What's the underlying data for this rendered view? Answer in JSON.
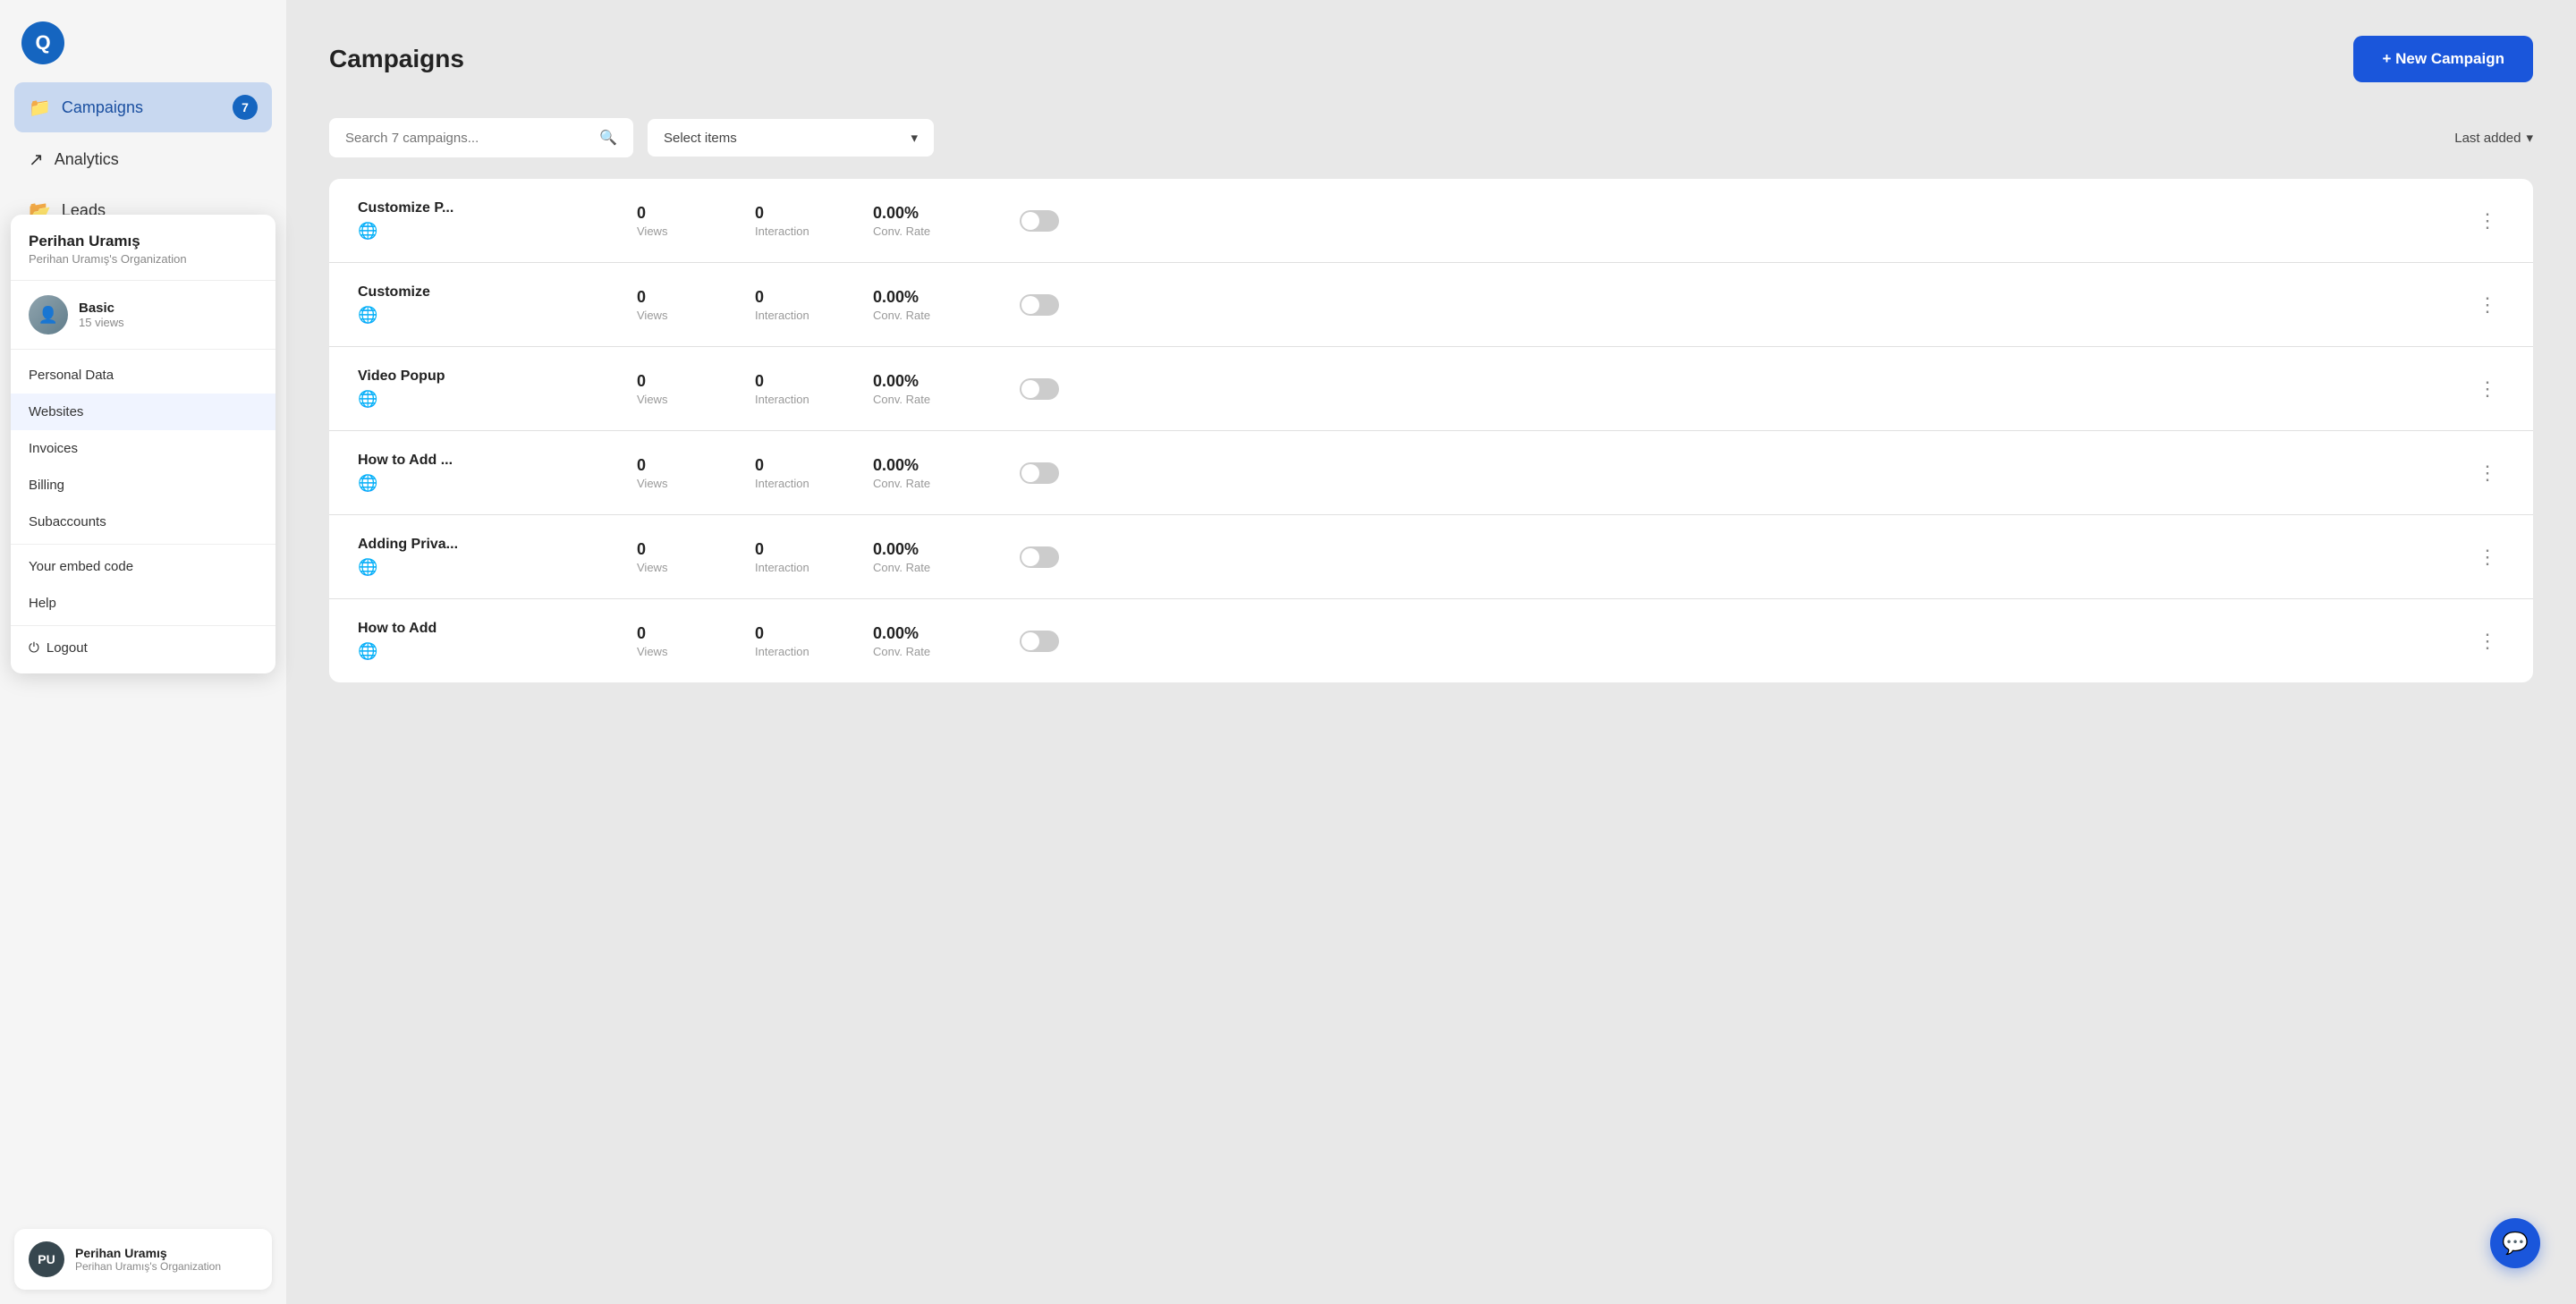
{
  "sidebar": {
    "logo_text": "Q",
    "nav_items": [
      {
        "id": "campaigns",
        "label": "Campaigns",
        "icon": "📁",
        "active": true,
        "badge": "7"
      },
      {
        "id": "analytics",
        "label": "Analytics",
        "icon": "↗",
        "active": false
      },
      {
        "id": "leads",
        "label": "Leads",
        "icon": "📂",
        "active": false
      }
    ]
  },
  "user_dropdown": {
    "name": "Perihan Uramış",
    "org": "Perihan Uramış's Organization",
    "plan": "Basic",
    "plan_views": "15 views",
    "menu_items": [
      {
        "id": "personal-data",
        "label": "Personal Data"
      },
      {
        "id": "websites",
        "label": "Websites",
        "active": true
      },
      {
        "id": "invoices",
        "label": "Invoices"
      },
      {
        "id": "billing",
        "label": "Billing"
      },
      {
        "id": "subaccounts",
        "label": "Subaccounts"
      }
    ],
    "embed_label": "Your embed code",
    "help_label": "Help",
    "logout_label": "Logout"
  },
  "user_bar": {
    "name": "Perihan Uramış",
    "org": "Perihan Uramış's Organization",
    "initials": "PU"
  },
  "header": {
    "title": "Campaigns",
    "new_campaign_label": "+ New Campaign"
  },
  "filters": {
    "search_placeholder": "Search 7 campaigns...",
    "select_items_label": "Select items",
    "sort_label": "Last added"
  },
  "campaigns": [
    {
      "name": "Customize P...",
      "views": "0",
      "interaction": "0",
      "conv_rate": "0.00%",
      "views_label": "Views",
      "interaction_label": "Interaction",
      "conv_label": "Conv. Rate"
    },
    {
      "name": "Customize",
      "views": "0",
      "interaction": "0",
      "conv_rate": "0.00%",
      "views_label": "Views",
      "interaction_label": "Interaction",
      "conv_label": "Conv. Rate"
    },
    {
      "name": "Video Popup",
      "views": "0",
      "interaction": "0",
      "conv_rate": "0.00%",
      "views_label": "Views",
      "interaction_label": "Interaction",
      "conv_label": "Conv. Rate"
    },
    {
      "name": "How to Add ...",
      "views": "0",
      "interaction": "0",
      "conv_rate": "0.00%",
      "views_label": "Views",
      "interaction_label": "Interaction",
      "conv_label": "Conv. Rate"
    },
    {
      "name": "Adding Priva...",
      "views": "0",
      "interaction": "0",
      "conv_rate": "0.00%",
      "views_label": "Views",
      "interaction_label": "Interaction",
      "conv_label": "Conv. Rate"
    },
    {
      "name": "How to Add",
      "views": "0",
      "interaction": "0",
      "conv_rate": "0.00%",
      "views_label": "Views",
      "interaction_label": "Interaction",
      "conv_label": "Conv. Rate"
    }
  ]
}
